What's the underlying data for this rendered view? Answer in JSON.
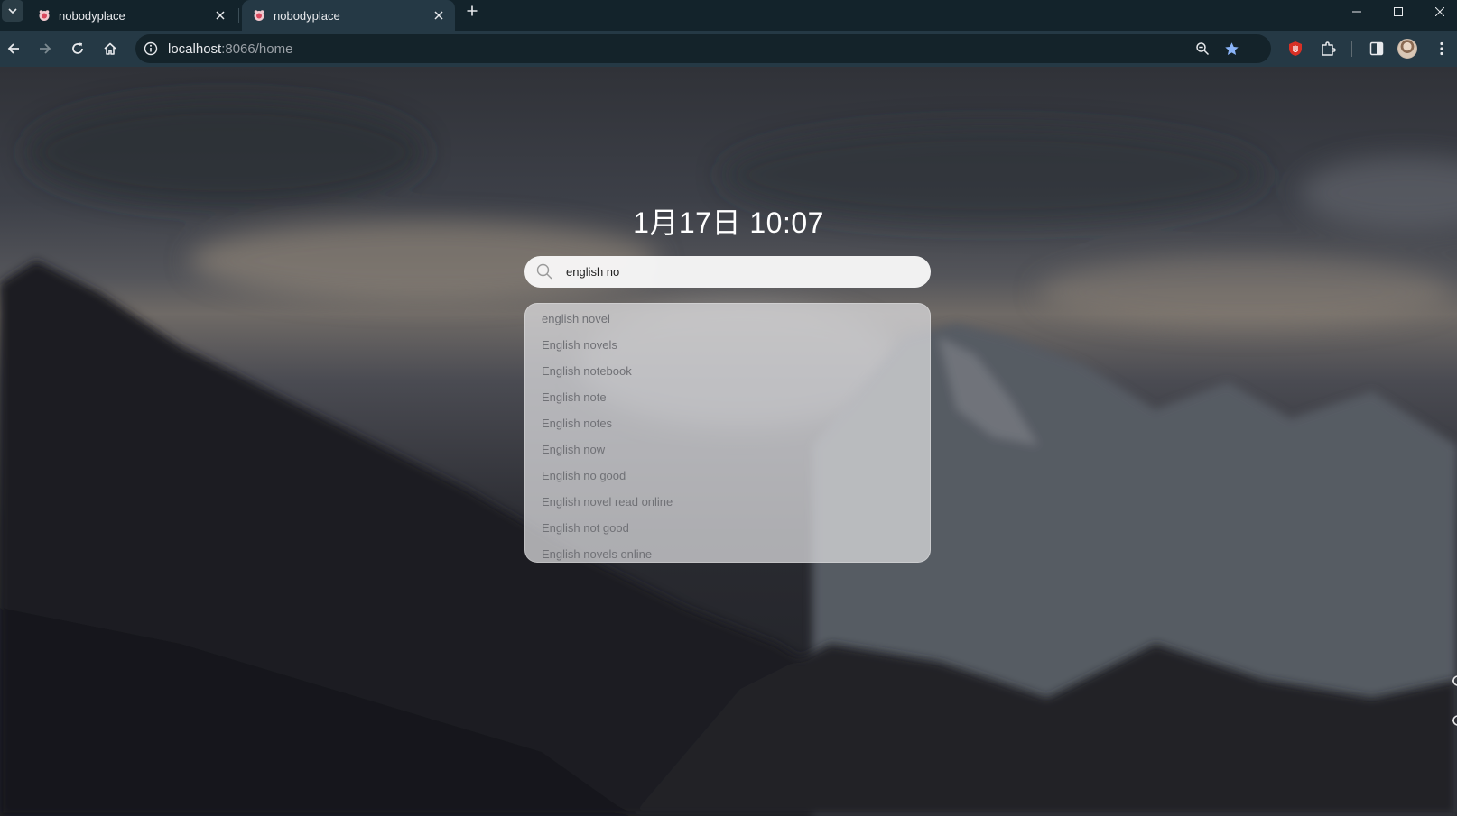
{
  "browser": {
    "tabs": [
      {
        "title": "nobodyplace",
        "active": false
      },
      {
        "title": "nobodyplace",
        "active": true
      }
    ],
    "address": {
      "host": "localhost",
      "path": ":8066/home"
    }
  },
  "page": {
    "clock": "1月17日 10:07",
    "search": {
      "value": "english no",
      "placeholder": ""
    },
    "suggestions": [
      "english novel",
      "English novels",
      "English notebook",
      "English note",
      "English notes",
      "English now",
      "English no good",
      "English novel read online",
      "English not good",
      "English novels online"
    ]
  },
  "colors": {
    "tabstrip": "#13232b",
    "toolbar": "#253945",
    "omnibox": "#14232a",
    "bookmark_star": "#8ab4f8",
    "extension_red": "#d93025"
  },
  "icons": [
    "tab-search-icon",
    "favicon-icon",
    "close-icon",
    "plus-icon",
    "back-icon",
    "forward-icon",
    "reload-icon",
    "home-icon",
    "info-icon",
    "zoom-icon",
    "star-icon",
    "extension-icon",
    "puzzle-icon",
    "side-panel-icon",
    "menu-icon",
    "search-icon",
    "gear-icon"
  ]
}
